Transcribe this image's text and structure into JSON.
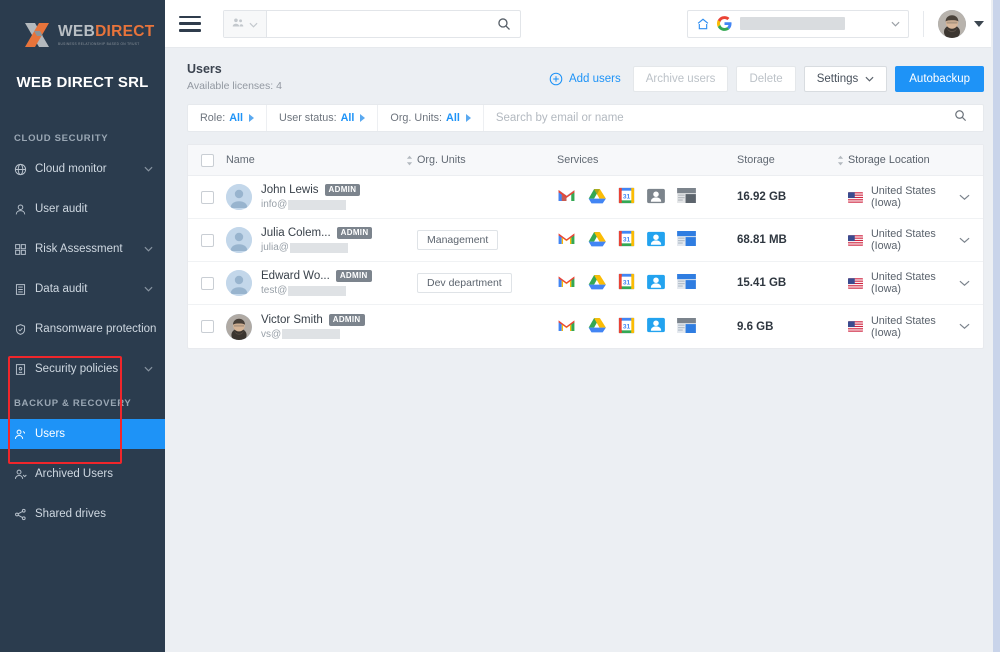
{
  "sidebar": {
    "logo": {
      "word1": "WEB",
      "word2": "DIRECT",
      "tagline": "BUSINESS RELATIONSHIP BASED ON TRUST"
    },
    "org_name": "WEB DIRECT SRL",
    "sections": [
      {
        "title": "CLOUD SECURITY",
        "items": [
          {
            "label": "Cloud monitor",
            "icon": "globe-icon",
            "chevron": true,
            "active": false
          },
          {
            "label": "User audit",
            "icon": "user-icon",
            "chevron": false,
            "active": false
          },
          {
            "label": "Risk Assessment",
            "icon": "grid-icon",
            "chevron": true,
            "active": false
          },
          {
            "label": "Data audit",
            "icon": "list-icon",
            "chevron": true,
            "active": false
          },
          {
            "label": "Ransomware protection",
            "icon": "shield-check-icon",
            "chevron": false,
            "active": false
          },
          {
            "label": "Security policies",
            "icon": "policy-icon",
            "chevron": true,
            "active": false
          }
        ]
      },
      {
        "title": "BACKUP & RECOVERY",
        "items": [
          {
            "label": "Users",
            "icon": "users-icon",
            "chevron": false,
            "active": true
          },
          {
            "label": "Archived Users",
            "icon": "archived-users-icon",
            "chevron": false,
            "active": false
          },
          {
            "label": "Shared drives",
            "icon": "share-icon",
            "chevron": false,
            "active": false
          }
        ]
      }
    ],
    "highlight_color": "#f0262b",
    "active_color": "#1e93f7"
  },
  "topbar": {
    "menu_icon": "hamburger-icon",
    "search": {
      "scope_icon": "people-icon",
      "value": "",
      "placeholder": "",
      "search_icon": "search-icon"
    },
    "domain_selector": {
      "home_icon": "home-icon",
      "brand_icon": "google-g-icon",
      "value": "",
      "caret": "▾"
    },
    "account": {
      "avatar": "user-photo-avatar",
      "caret": "▾"
    }
  },
  "page": {
    "title": "Users",
    "subtitle": "Available licenses: 4",
    "actions": {
      "add_users": "Add users",
      "archive_users": "Archive users",
      "delete": "Delete",
      "settings": "Settings",
      "autobackup": "Autobackup"
    }
  },
  "filters": [
    {
      "label": "Role:",
      "value": "All"
    },
    {
      "label": "User status:",
      "value": "All"
    },
    {
      "label": "Org. Units:",
      "value": "All"
    }
  ],
  "filter_search_placeholder": "Search by email or name",
  "table": {
    "columns": [
      {
        "key": "check",
        "label": ""
      },
      {
        "key": "name",
        "label": "Name",
        "sortable": true
      },
      {
        "key": "org",
        "label": "Org. Units"
      },
      {
        "key": "services",
        "label": "Services"
      },
      {
        "key": "storage",
        "label": "Storage",
        "sortable": true
      },
      {
        "key": "location",
        "label": "Storage Location"
      }
    ],
    "rows": [
      {
        "name": "John Lewis",
        "badge": "ADMIN",
        "email_prefix": "info@",
        "avatar": "placeholder-avatar",
        "org_unit": "",
        "services": [
          {
            "name": "gmail-icon",
            "enabled": true
          },
          {
            "name": "google-drive-icon",
            "enabled": true
          },
          {
            "name": "google-calendar-icon",
            "enabled": true
          },
          {
            "name": "google-contacts-icon",
            "enabled": false
          },
          {
            "name": "google-sites-icon",
            "enabled": false
          }
        ],
        "storage": "16.92 GB",
        "location": "United States (Iowa)",
        "flag": "us-flag-icon"
      },
      {
        "name": "Julia Colem...",
        "badge": "ADMIN",
        "email_prefix": "julia@",
        "avatar": "placeholder-avatar",
        "org_unit": "Management",
        "services": [
          {
            "name": "gmail-icon",
            "enabled": true
          },
          {
            "name": "google-drive-icon",
            "enabled": true
          },
          {
            "name": "google-calendar-icon",
            "enabled": true
          },
          {
            "name": "google-contacts-icon",
            "enabled": true
          },
          {
            "name": "google-sites-icon",
            "enabled": true
          }
        ],
        "storage": "68.81 MB",
        "location": "United States (Iowa)",
        "flag": "us-flag-icon"
      },
      {
        "name": "Edward Wo...",
        "badge": "ADMIN",
        "email_prefix": "test@",
        "avatar": "placeholder-avatar",
        "org_unit": "Dev department",
        "services": [
          {
            "name": "gmail-icon",
            "enabled": true
          },
          {
            "name": "google-drive-icon",
            "enabled": true
          },
          {
            "name": "google-calendar-icon",
            "enabled": true
          },
          {
            "name": "google-contacts-icon",
            "enabled": true
          },
          {
            "name": "google-sites-icon",
            "enabled": true
          }
        ],
        "storage": "15.41 GB",
        "location": "United States (Iowa)",
        "flag": "us-flag-icon"
      },
      {
        "name": "Victor Smith",
        "badge": "ADMIN",
        "email_prefix": "vs@",
        "avatar": "photo-avatar",
        "org_unit": "",
        "services": [
          {
            "name": "gmail-icon",
            "enabled": true
          },
          {
            "name": "google-drive-icon",
            "enabled": true
          },
          {
            "name": "google-calendar-icon",
            "enabled": true
          },
          {
            "name": "google-contacts-icon",
            "enabled": true
          },
          {
            "name": "google-sites-icon",
            "enabled": true
          }
        ],
        "storage": "9.6 GB",
        "location": "United States (Iowa)",
        "flag": "us-flag-icon"
      }
    ]
  }
}
